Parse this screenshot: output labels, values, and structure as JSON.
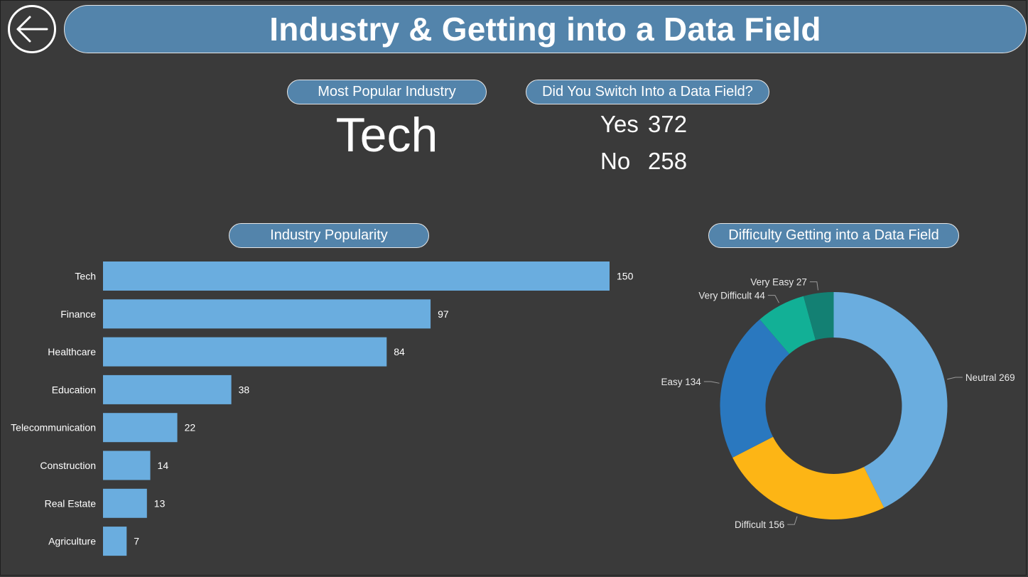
{
  "header": {
    "title": "Industry & Getting into a Data Field",
    "back_icon": "arrow-left-icon"
  },
  "kpis": {
    "popular_title": "Most Popular Industry",
    "popular_value": "Tech",
    "switch_title": "Did You Switch Into a Data Field?",
    "switch_rows": [
      {
        "label": "Yes",
        "value": "372"
      },
      {
        "label": "No",
        "value": "258"
      }
    ]
  },
  "charts": {
    "bar_title": "Industry Popularity",
    "donut_title": "Difficulty Getting into a Data Field"
  },
  "colors": {
    "background": "#3a3a3a",
    "pill": "#5384ab",
    "bar": "#6aaddf"
  },
  "chart_data": [
    {
      "type": "bar",
      "orientation": "horizontal",
      "title": "Industry Popularity",
      "categories": [
        "Tech",
        "Finance",
        "Healthcare",
        "Education",
        "Telecommunication",
        "Construction",
        "Real Estate",
        "Agriculture"
      ],
      "values": [
        150,
        97,
        84,
        38,
        22,
        14,
        13,
        7
      ],
      "data_labels": true,
      "color": "#6aaddf"
    },
    {
      "type": "pie",
      "style": "donut",
      "title": "Difficulty Getting into a Data Field",
      "categories": [
        "Neutral",
        "Difficult",
        "Easy",
        "Very Difficult",
        "Very Easy"
      ],
      "values": [
        269,
        156,
        134,
        44,
        27
      ],
      "colors": [
        "#6aaddf",
        "#fdb515",
        "#2a78bf",
        "#12b096",
        "#138073"
      ]
    }
  ]
}
